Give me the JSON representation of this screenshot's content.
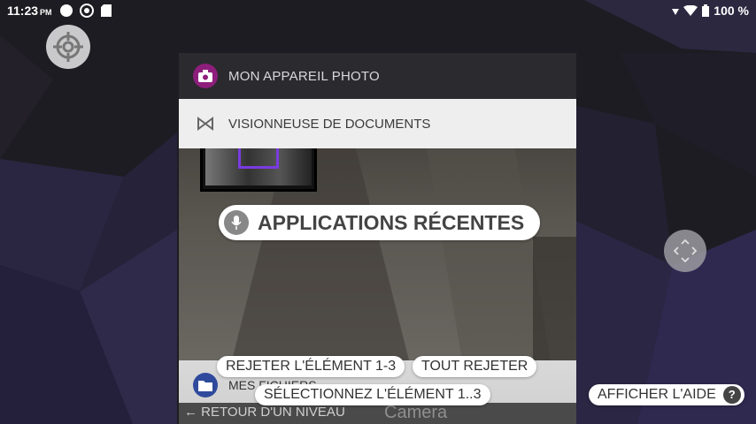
{
  "status_bar": {
    "time": "11:23",
    "ampm": "PM",
    "battery": "100 %"
  },
  "recents": {
    "camera_card_title": "MON APPAREIL PHOTO",
    "docs_card_title": "VISIONNEUSE DE DOCUMENTS",
    "files_card_title": "MES FICHIERS",
    "back_level": "← RETOUR D'UN NIVEAU",
    "camera_label": "Camera"
  },
  "voice": {
    "recent_apps": "APPLICATIONS RÉCENTES",
    "reject_item": "REJETER L'ÉLÉMENT 1-3",
    "reject_all": "TOUT REJETER",
    "select_item": "SÉLECTIONNEZ L'ÉLÉMENT 1..3",
    "show_help": "AFFICHER L'AIDE",
    "help_symbol": "?"
  },
  "icons": {
    "camera_app": "camera-icon",
    "docs_app": "document-viewer-icon",
    "files_app": "folder-icon",
    "mic": "mic-icon",
    "target": "crosshair-icon",
    "dpad": "dpad-icon"
  },
  "colors": {
    "camera_accent": "#8e1e7b",
    "files_accent": "#2f4a9c",
    "selection_frame": "#7a3be0"
  }
}
